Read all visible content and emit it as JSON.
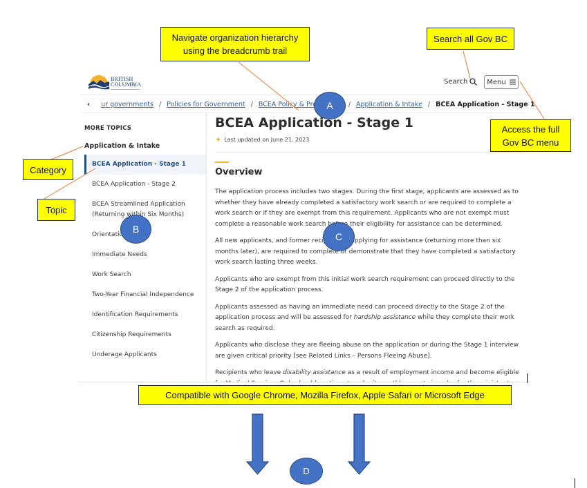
{
  "header": {
    "logo_line1": "BRITISH",
    "logo_line2": "COLUMBIA",
    "search_label": "Search",
    "search_icon": "search-icon",
    "menu_label": "Menu",
    "menu_icon": "hamburger-icon"
  },
  "breadcrumb": {
    "back_icon": "chevron-left-icon",
    "back_glyph": "‹",
    "separator": "/",
    "items": [
      {
        "label": "ur governments"
      },
      {
        "label": "Policies for Government"
      },
      {
        "label": "BCEA Policy & Procedures"
      },
      {
        "label": "Application & Intake"
      }
    ],
    "current": "BCEA Application - Stage 1"
  },
  "sidebar": {
    "heading": "MORE TOPICS",
    "category": "Application & Intake",
    "items": [
      {
        "label": "BCEA Application - Stage 1",
        "active": true
      },
      {
        "label": "BCEA Application - Stage 2"
      },
      {
        "label": "BCEA Streamlined Application (Returning within Six Months)"
      },
      {
        "label": "Orientation"
      },
      {
        "label": "Immediate Needs"
      },
      {
        "label": "Work Search"
      },
      {
        "label": "Two-Year Financial Independence"
      },
      {
        "label": "Identification Requirements"
      },
      {
        "label": "Citizenship Requirements"
      },
      {
        "label": "Underage Applicants"
      }
    ]
  },
  "main": {
    "title": "BCEA Application - Stage 1",
    "updated_icon": "star-icon",
    "updated_glyph": "✦",
    "last_updated": "Last updated on June 21, 2023",
    "section_heading": "Overview",
    "paragraphs": [
      "The application process includes two stages.  During the first stage, applicants are assessed as to whether they have already completed a satisfactory work search or are required to complete a work search or if they are exempt from this requirement. Applicants who are not exempt must complete a reasonable work search before their eligibility for assistance can be determined.",
      "All new applicants, and former recipients reapplying for assistance (returning more than six months later), are required to complete or demonstrate that they have completed a satisfactory work search lasting three weeks.",
      "Applicants who are exempt from this initial work search requirement can proceed directly to the Stage 2 of the application process.",
      "Applicants who disclose they are fleeing abuse on the application or during the Stage 1 interview are given critical priority [see Related Links – Persons Fleeing Abuse].",
      "Recipients who leave disability assistance as a result of employment income and become eligible for Medical Services Only should continue to submit monthly reports in order for the ministry to re-establish eligibility for disability assistance when:"
    ],
    "p4_a": "Applicants assessed as having an immediate need can proceed directly to the Stage 2 of the application process and will be assessed for ",
    "p4_em": "hardship assistance",
    "p4_b": " while they complete their work search as required.",
    "p6_a": "Recipients who leave ",
    "p6_em": "disability assistance",
    "p6_b": " as a result of employment income and become eligible for Medical Services Only should continue to submit monthly reports in order for the ministry to re-establish eligibility for disability assistance when:"
  },
  "annotations": {
    "breadcrumb_callout": "Navigate organization hierarchy using the breadcrumb trail",
    "search_callout": "Search all Gov BC",
    "menu_callout": "Access the full Gov BC menu",
    "category_callout": "Category",
    "topic_callout": "Topic",
    "compat_callout": "Compatible with Google Chrome, Mozilla Firefox, Apple Safari or Microsoft Edge",
    "badges": [
      "A",
      "B",
      "C",
      "D"
    ],
    "colors": {
      "callout_fill": "#ffff00",
      "badge_fill": "#4472c4",
      "leader_line": "#ed7d31",
      "arrow_fill": "#4472c4"
    }
  }
}
